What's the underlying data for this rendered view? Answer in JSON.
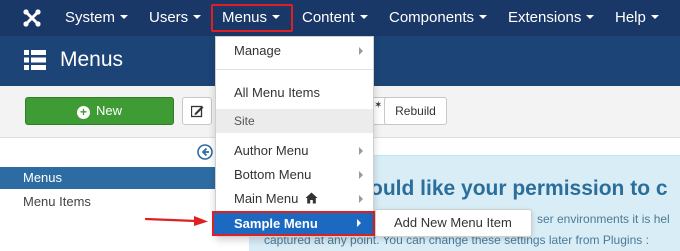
{
  "nav": {
    "items": [
      {
        "label": "System"
      },
      {
        "label": "Users"
      },
      {
        "label": "Menus"
      },
      {
        "label": "Content"
      },
      {
        "label": "Components"
      },
      {
        "label": "Extensions"
      },
      {
        "label": "Help"
      }
    ],
    "brand_icon": "joomla-logo-icon",
    "background": "#1a3867"
  },
  "header": {
    "title": "Menus",
    "icon": "list-icon",
    "background": "#1d4477"
  },
  "toolbar": {
    "new_label": "New",
    "rebuild_label": "Rebuild",
    "accent": "#3f9c35"
  },
  "sidebar": {
    "items": [
      {
        "label": "Menus",
        "active": true
      },
      {
        "label": "Menu Items",
        "active": false
      }
    ]
  },
  "dropdown": {
    "items": [
      {
        "label": "Manage",
        "has_submenu": true
      },
      {
        "label": "All Menu Items",
        "has_submenu": false
      },
      {
        "label": "Site",
        "is_header": true
      },
      {
        "label": "Author Menu",
        "has_submenu": true
      },
      {
        "label": "Bottom Menu",
        "has_submenu": true
      },
      {
        "label": "Main Menu",
        "has_submenu": true,
        "icon": "home-icon"
      },
      {
        "label": "Sample Menu",
        "has_submenu": true,
        "selected": true
      }
    ],
    "selected_color": "#1b69c0",
    "highlight_color": "#e02020"
  },
  "submenu": {
    "items": [
      {
        "label": "Add New Menu Item"
      }
    ]
  },
  "message": {
    "heading": "ould like your permission to c",
    "line1": "ser environments it is hel",
    "line2": "captured at any point. You can change these settings later from Plugins :",
    "background": "#d9edf7"
  }
}
